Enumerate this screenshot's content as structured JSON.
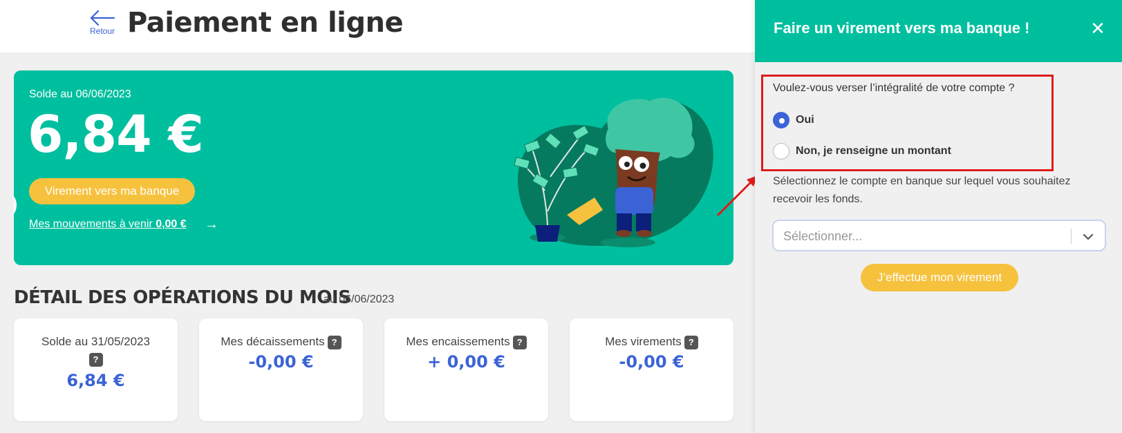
{
  "header": {
    "back_label": "Retour",
    "title": "Paiement en ligne"
  },
  "hero": {
    "solde_label": "Solde au 06/06/2023",
    "amount": "6,84 €",
    "transfer_button": "Virement vers ma banque",
    "movements_text": "Mes mouvements à venir ",
    "movements_amount": "0,00 €"
  },
  "operations": {
    "title": "DÉTAIL DES OPÉRATIONS DU MOIS",
    "date": "au 06/06/2023",
    "help_glyph": "?",
    "cards": [
      {
        "label": "Solde au 31/05/2023",
        "value": "6,84 €"
      },
      {
        "label": "Mes décaissements",
        "value": "-0,00 €"
      },
      {
        "label": "Mes encaissements",
        "value": "+ 0,00 €"
      },
      {
        "label": "Mes virements",
        "value": "-0,00 €"
      }
    ]
  },
  "panel": {
    "title": "Faire un virement vers ma banque !",
    "close_glyph": "✕",
    "question": "Voulez-vous verser l’intégralité de votre compte ?",
    "options": [
      {
        "label": "Oui",
        "checked": true
      },
      {
        "label": "Non, je renseigne un montant",
        "checked": false
      }
    ],
    "select_description": "Sélectionnez le compte en banque sur lequel vous souhaitez recevoir les fonds.",
    "select_placeholder": "Sélectionner...",
    "submit_button": "J’effectue mon virement"
  },
  "colors": {
    "accent_green": "#00bf9f",
    "button_yellow": "#f6c23e",
    "value_blue": "#3b63d6",
    "highlight_red": "#e01b1b"
  }
}
